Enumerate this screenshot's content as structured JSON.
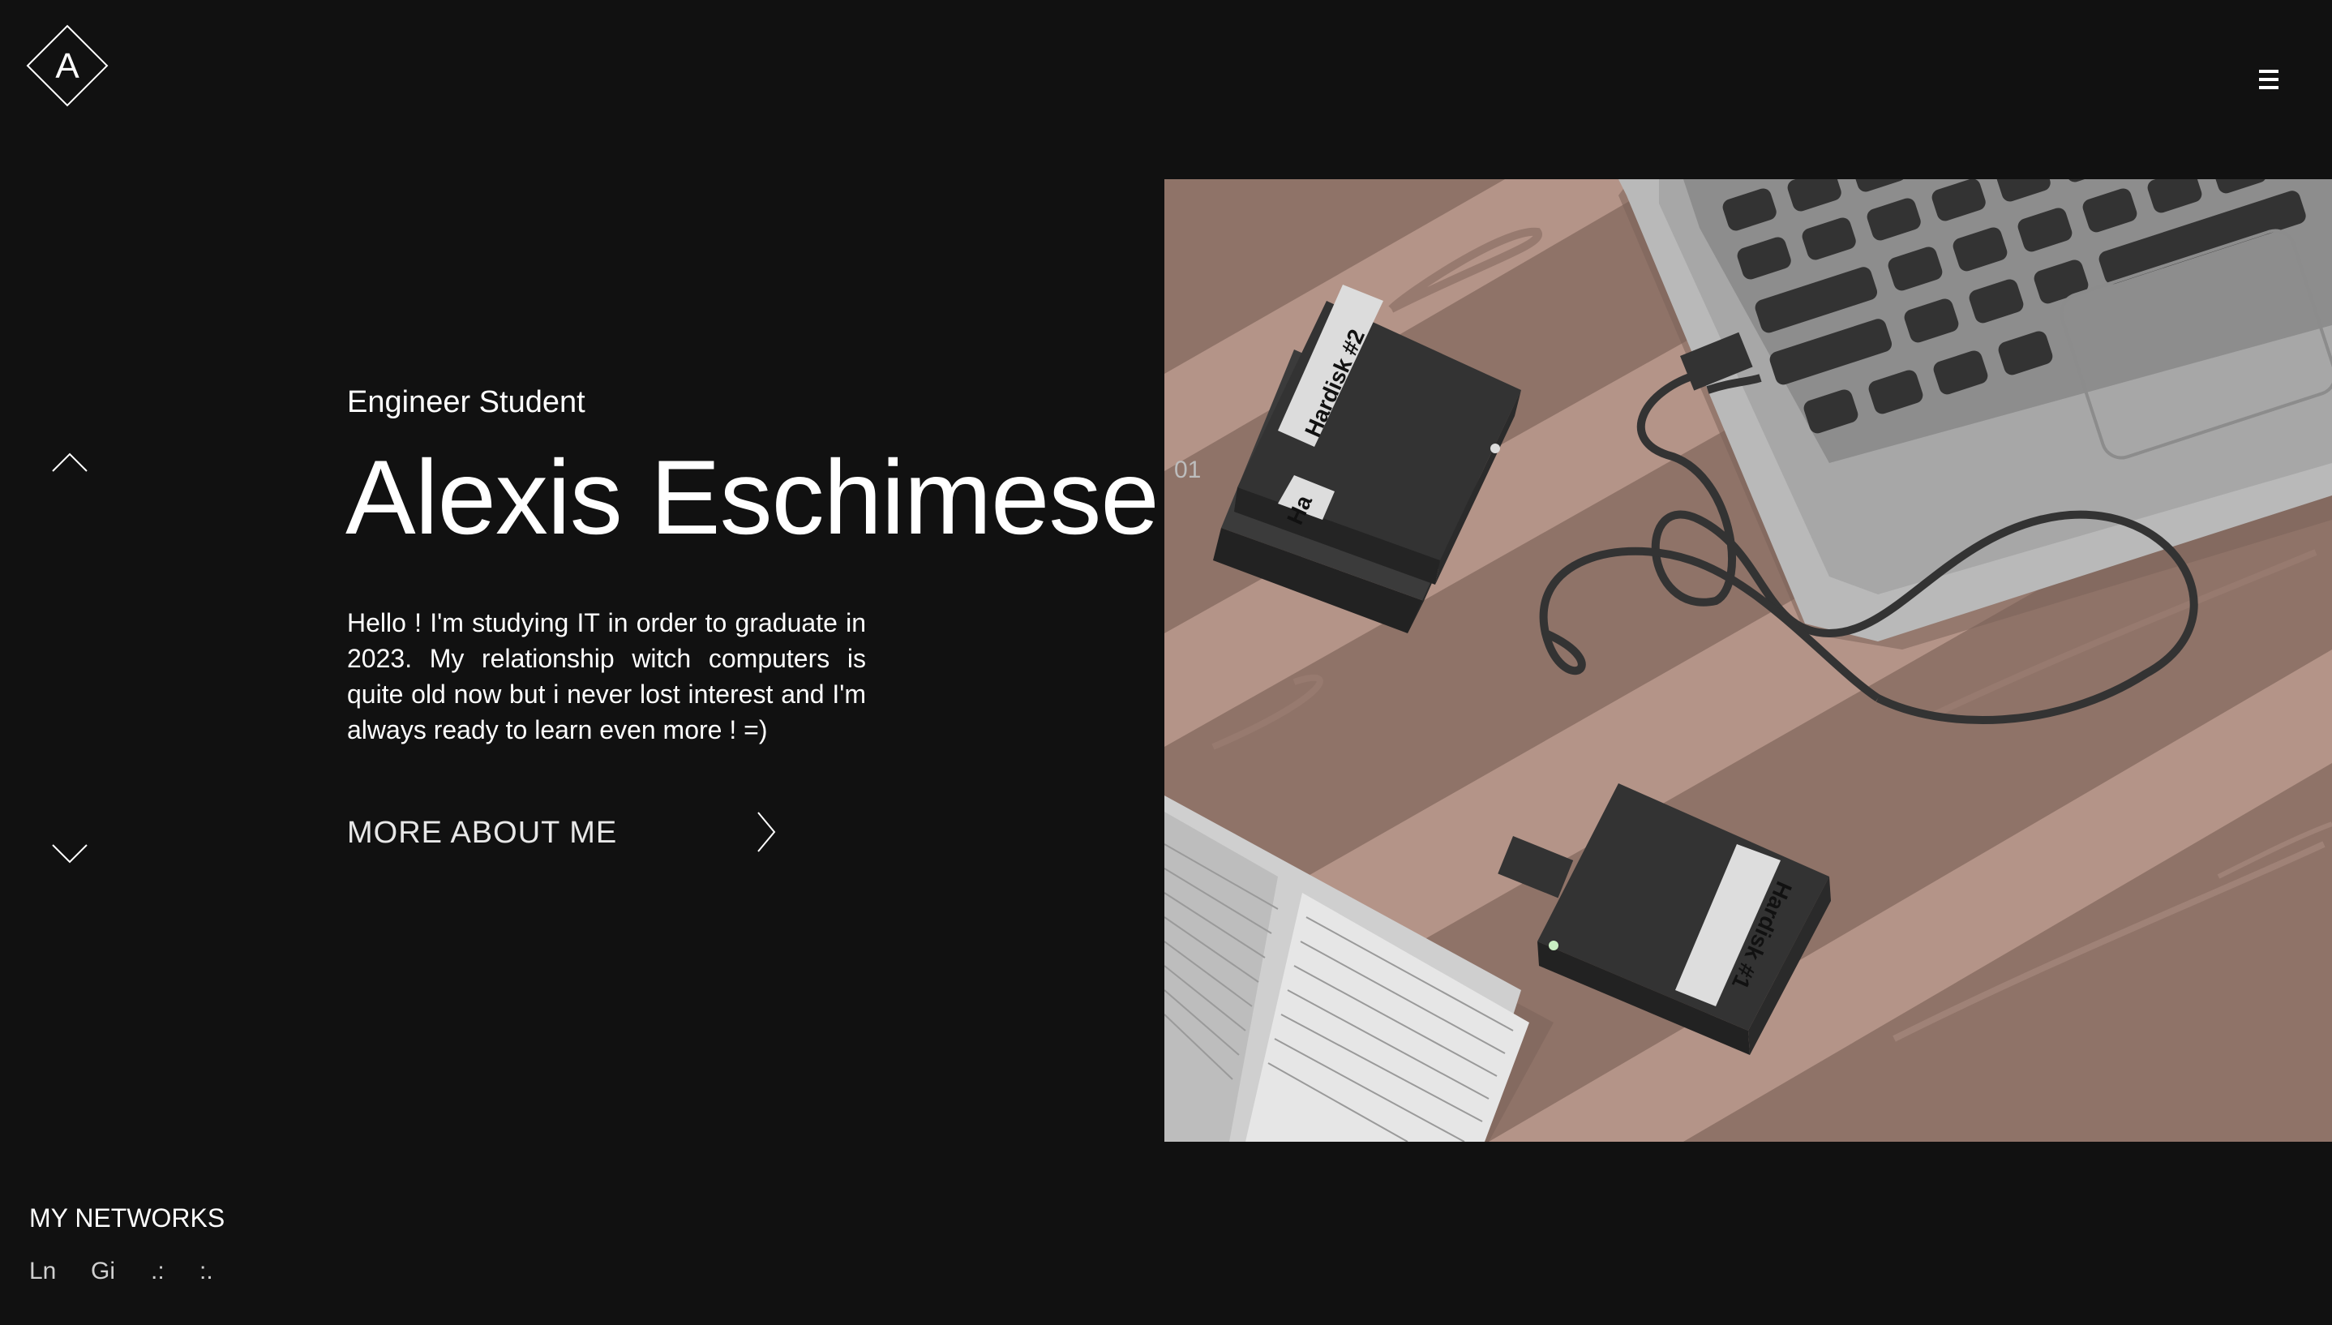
{
  "brand": {
    "logo_letter": "A"
  },
  "nav": {
    "menu_icon": "hamburger-icon",
    "prev_icon": "chevron-up-icon",
    "next_icon": "chevron-down-icon"
  },
  "hero": {
    "subtitle": "Engineer Student",
    "title": "Alexis Eschimese",
    "slide_number": "01",
    "intro": "Hello ! I'm studying IT in order to graduate in 2023. My relationship witch computers is quite old now but i never lost interest and I'm always ready to learn even more ! =)",
    "cta_label": "MORE ABOUT ME",
    "cta_icon": "chevron-right-icon",
    "image": {
      "drive_label_1": "Hardisk #1",
      "drive_label_2": "Hardisk #2",
      "drive_label_3": "Ha"
    }
  },
  "networks": {
    "title": "MY NETWORKS",
    "items": [
      {
        "label": "Ln"
      },
      {
        "label": "Gi"
      },
      {
        "label": ".:"
      },
      {
        "label": ":."
      }
    ]
  },
  "colors": {
    "background": "#111111",
    "text": "#ffffff",
    "desk_dark": "#8f7368",
    "desk_light": "#b49488",
    "laptop": "#a8a8a8",
    "drive": "#333333"
  }
}
